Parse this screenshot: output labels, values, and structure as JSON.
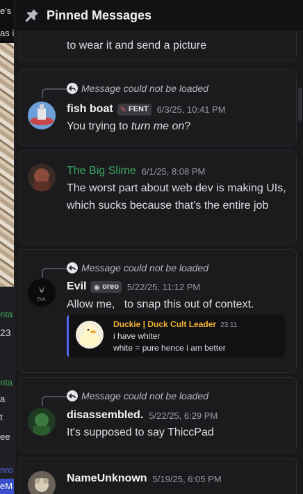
{
  "background": {
    "left_text": [
      "e's",
      "as i",
      "nta",
      "23",
      "nta",
      "a",
      "t",
      "ee",
      "nro",
      "eM"
    ]
  },
  "header": {
    "title": "Pinned Messages",
    "icon": "pin-icon"
  },
  "messages": [
    {
      "text_lines": [
        "to wear it and send a picture"
      ]
    },
    {
      "reply_text": "Message could not be loaded",
      "author": "fish boat",
      "tag": "FENT",
      "timestamp": "6/3/25, 10:41 PM",
      "text_before": "You trying to ",
      "text_italic": "turn me on",
      "text_after": "?"
    },
    {
      "author": "The Big Slime",
      "author_color": "#3ba55d",
      "timestamp": "6/1/25, 8:08 PM",
      "text": "The worst part about web dev is making UIs, which sucks because that's the entire job"
    },
    {
      "reply_text": "Message could not be loaded",
      "author": "Evil",
      "tag": "oreo",
      "avatar_text": "EVIL",
      "timestamp": "5/22/25, 11:12 PM",
      "text": "Allow me,   to snap this out of context.",
      "embed": {
        "author": "Duckie | Duck Cult Leader",
        "time": "23:11",
        "line1": "i have whiter",
        "line2": "white = pure hence i am better"
      }
    },
    {
      "reply_text": "Message could not be loaded",
      "author": "disassembled.",
      "timestamp": "5/22/25, 6:29 PM",
      "text": "It's supposed to say ThiccPad"
    },
    {
      "author": "NameUnknown",
      "timestamp": "5/19/25, 6:05 PM"
    }
  ],
  "colors": {
    "accent": "#5865f2",
    "panel_bg": "#19191c",
    "card_bg": "#1b1b1e",
    "embed_author": "#f0b232"
  }
}
